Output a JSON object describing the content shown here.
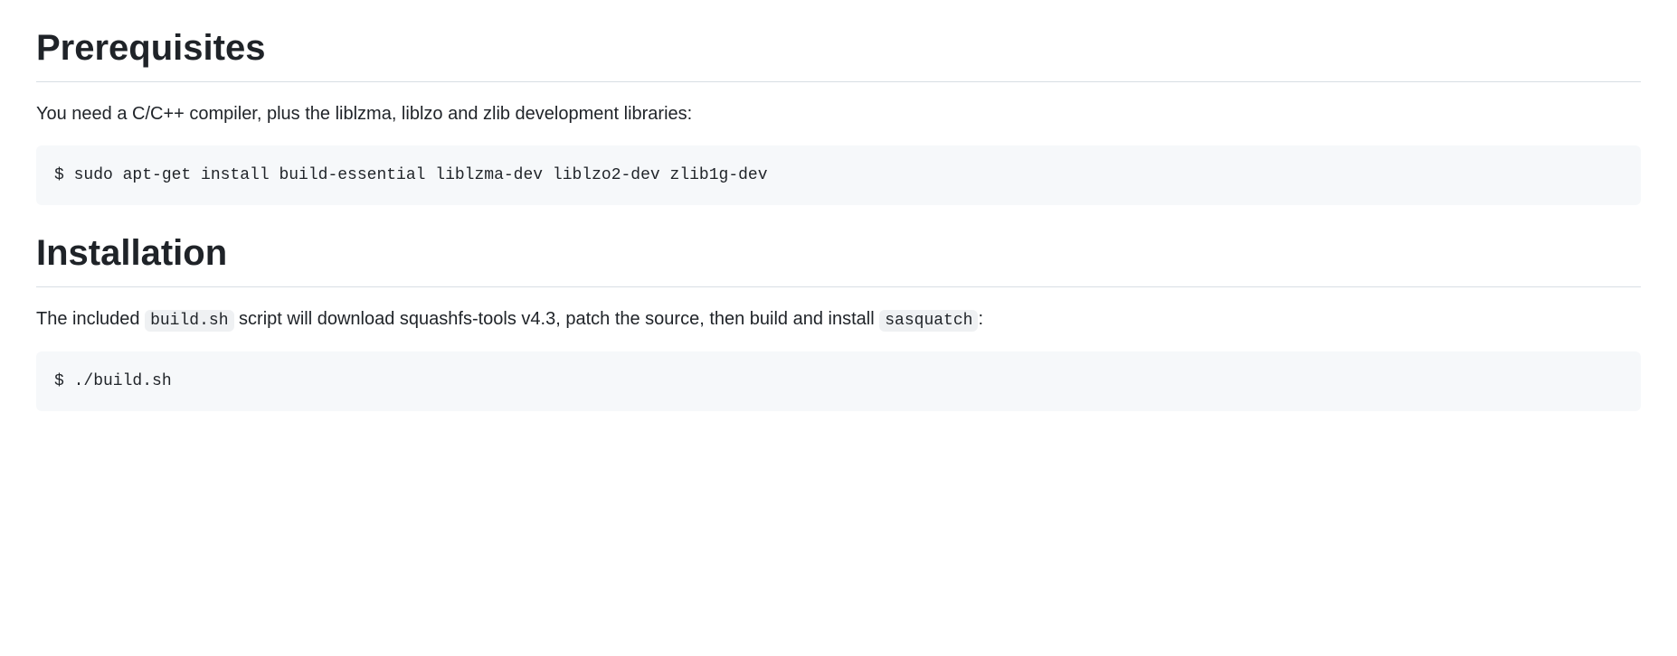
{
  "sections": {
    "prerequisites": {
      "heading": "Prerequisites",
      "description": "You need a C/C++ compiler, plus the liblzma, liblzo and zlib development libraries:",
      "code": "$ sudo apt-get install build-essential liblzma-dev liblzo2-dev zlib1g-dev"
    },
    "installation": {
      "heading": "Installation",
      "description_parts": {
        "part1": "The included ",
        "code1": "build.sh",
        "part2": " script will download squashfs-tools v4.3, patch the source, then build and install ",
        "code2": "sasquatch",
        "part3": ":"
      },
      "code": "$ ./build.sh"
    }
  }
}
